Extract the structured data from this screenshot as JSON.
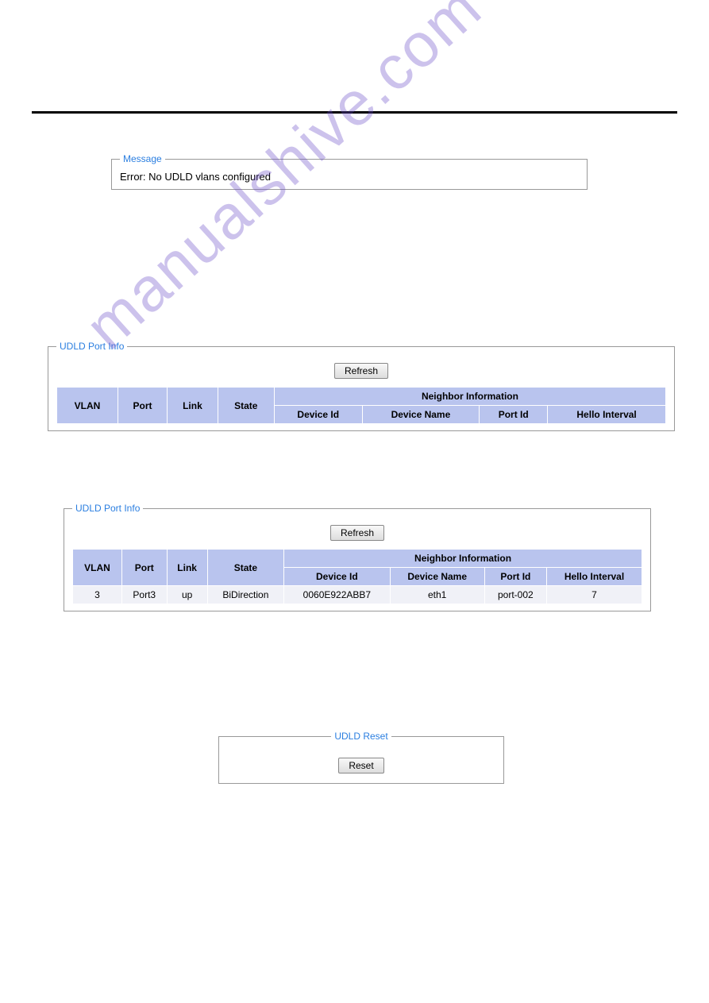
{
  "watermark": "manualshive.com",
  "message": {
    "legend": "Message",
    "text": "Error: No UDLD vlans configured"
  },
  "portInfo1": {
    "legend": "UDLD Port Info",
    "refresh": "Refresh",
    "headers": {
      "vlan": "VLAN",
      "port": "Port",
      "link": "Link",
      "state": "State",
      "neighborGroup": "Neighbor Information",
      "deviceId": "Device Id",
      "deviceName": "Device Name",
      "portId": "Port Id",
      "helloInterval": "Hello Interval"
    }
  },
  "portInfo2": {
    "legend": "UDLD Port Info",
    "refresh": "Refresh",
    "headers": {
      "vlan": "VLAN",
      "port": "Port",
      "link": "Link",
      "state": "State",
      "neighborGroup": "Neighbor Information",
      "deviceId": "Device Id",
      "deviceName": "Device Name",
      "portId": "Port Id",
      "helloInterval": "Hello Interval"
    },
    "row": {
      "vlan": "3",
      "port": "Port3",
      "link": "up",
      "state": "BiDirection",
      "deviceId": "0060E922ABB7",
      "deviceName": "eth1",
      "portId": "port-002",
      "helloInterval": "7"
    }
  },
  "reset": {
    "legend": "UDLD Reset",
    "button": "Reset"
  }
}
